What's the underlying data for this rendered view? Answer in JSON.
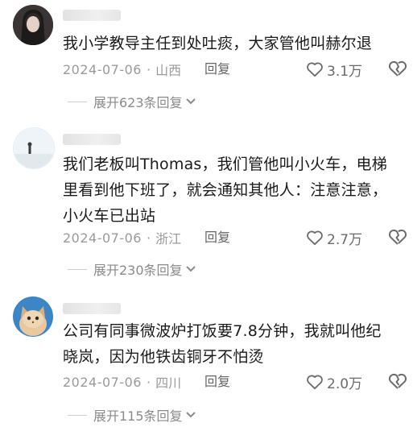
{
  "comments": [
    {
      "text": "我小学教导主任到处吐痰，大家管他叫赫尔退",
      "date": "2024-07-06",
      "location": "山西",
      "reply_label": "回复",
      "likes": "3.1万",
      "expand_label": "展开623条回复"
    },
    {
      "text": "我们老板叫Thomas，我们管他叫小火车，电梯\n里看到他下班了，就会通知其他人：注意注意，\n小火车已出站",
      "date": "2024-07-06",
      "location": "浙江",
      "reply_label": "回复",
      "likes": "2.7万",
      "expand_label": "展开230条回复"
    },
    {
      "text": "公司有同事微波炉打饭要7.8分钟，我就叫他纪\n晓岚，因为他铁齿铜牙不怕烫",
      "date": "2024-07-06",
      "location": "四川",
      "reply_label": "回复",
      "likes": "2.0万",
      "expand_label": "展开115条回复"
    }
  ],
  "colors": {
    "meta": "#9a9a9a",
    "text": "#1a1a1a",
    "background": "#ffffff"
  },
  "icons": [
    "heart-outline-icon",
    "broken-heart-icon",
    "chevron-down-icon"
  ]
}
